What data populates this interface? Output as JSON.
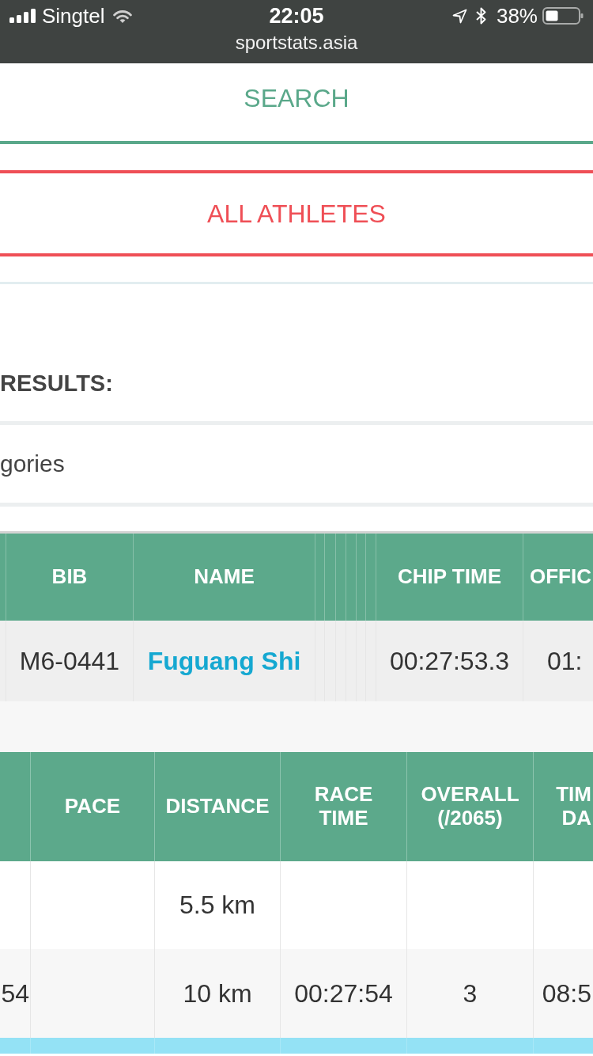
{
  "status_bar": {
    "carrier": "Singtel",
    "time": "22:05",
    "battery": "38%",
    "url": "sportstats.asia"
  },
  "tabs": [
    {
      "label": "SEARCH",
      "color": "#5aa88a"
    },
    {
      "label": "ALL ATHLETES",
      "color": "#ef4f56"
    }
  ],
  "results": {
    "heading": "RESULTS:",
    "category": "gories"
  },
  "table_1": {
    "columns": [
      {
        "kind": "spacer"
      },
      {
        "kind": "text",
        "lines": [
          "BIB"
        ]
      },
      {
        "kind": "link",
        "lines": [
          "NAME"
        ]
      },
      {
        "kind": "spacer"
      },
      {
        "kind": "spacer"
      },
      {
        "kind": "spacer"
      },
      {
        "kind": "spacer"
      },
      {
        "kind": "spacer"
      },
      {
        "kind": "spacer"
      },
      {
        "kind": "text",
        "lines": [
          "CHIP TIME"
        ]
      },
      {
        "kind": "text",
        "lines": [
          "OFFIC"
        ]
      }
    ],
    "rows": [
      {
        "cells": [
          null,
          "M6-0441",
          "Fuguang Shi",
          null,
          null,
          null,
          null,
          null,
          null,
          "00:27:53.3",
          "01:"
        ]
      }
    ]
  },
  "table_2": {
    "columns": [
      {
        "kind": "text"
      },
      {
        "kind": "text",
        "lines": [
          "PACE"
        ]
      },
      {
        "kind": "text",
        "lines": [
          "DISTANCE"
        ]
      },
      {
        "kind": "text",
        "lines": [
          "RACE",
          "TIME"
        ]
      },
      {
        "kind": "text",
        "lines": [
          "OVERALL",
          "(/2065)"
        ]
      },
      {
        "kind": "text",
        "lines": [
          "TIM",
          "DA"
        ]
      }
    ],
    "rows": [
      {
        "highlighted": false,
        "cells": [
          null,
          null,
          "5.5 km",
          null,
          null,
          null
        ]
      },
      {
        "highlighted": false,
        "cells": [
          "54",
          null,
          "10 km",
          "00:27:54",
          "3",
          "08:5"
        ]
      },
      {
        "highlighted": true,
        "cells": [
          null,
          null,
          null,
          null,
          null,
          null
        ]
      }
    ]
  }
}
